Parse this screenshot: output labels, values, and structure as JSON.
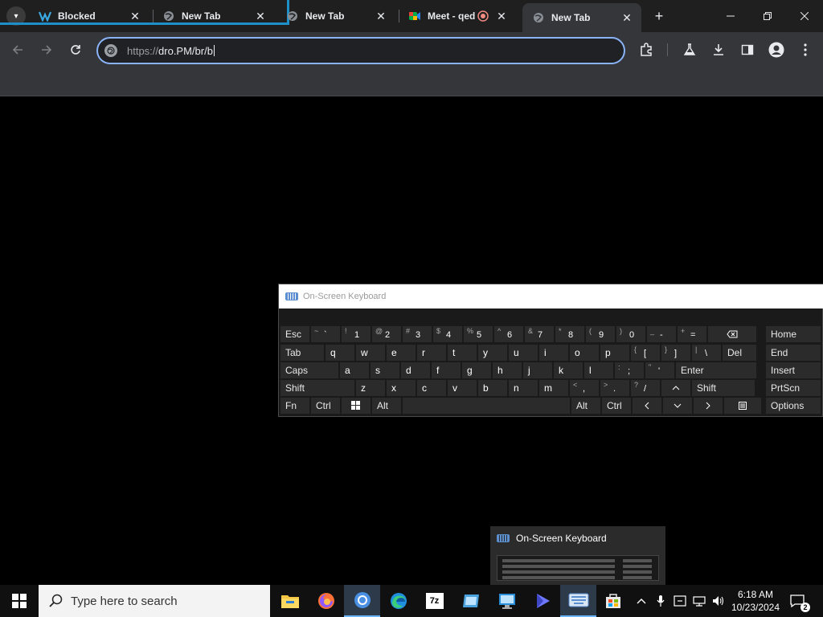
{
  "browser": {
    "tabs": [
      {
        "title": "Blocked",
        "icon": "blocked-favicon"
      },
      {
        "title": "New Tab",
        "icon": "globe-icon"
      },
      {
        "title": "New Tab",
        "icon": "globe-icon"
      },
      {
        "title": "Meet - qed",
        "icon": "meet-icon"
      },
      {
        "title": "New Tab",
        "icon": "globe-icon"
      }
    ],
    "address": {
      "scheme": "https://",
      "value": "dro.PM/br/b"
    },
    "group_color": "#1e90c9"
  },
  "osk": {
    "title": "On-Screen Keyboard",
    "row1": [
      {
        "shift": "~",
        "main": "`"
      },
      {
        "shift": "!",
        "main": "1"
      },
      {
        "shift": "@",
        "main": "2"
      },
      {
        "shift": "#",
        "main": "3"
      },
      {
        "shift": "$",
        "main": "4"
      },
      {
        "shift": "%",
        "main": "5"
      },
      {
        "shift": "^",
        "main": "6"
      },
      {
        "shift": "&",
        "main": "7"
      },
      {
        "shift": "*",
        "main": "8"
      },
      {
        "shift": "(",
        "main": "9"
      },
      {
        "shift": ")",
        "main": "0"
      },
      {
        "shift": "_",
        "main": "-"
      },
      {
        "shift": "+",
        "main": "="
      }
    ],
    "row2_letters": [
      "q",
      "w",
      "e",
      "r",
      "t",
      "y",
      "u",
      "i",
      "o",
      "p"
    ],
    "row2_brackets": [
      {
        "shift": "{",
        "main": "["
      },
      {
        "shift": "}",
        "main": "]"
      },
      {
        "shift": "|",
        "main": "\\"
      }
    ],
    "row3_letters": [
      "a",
      "s",
      "d",
      "f",
      "g",
      "h",
      "j",
      "k",
      "l"
    ],
    "row3_punct": [
      {
        "shift": ":",
        "main": ";"
      },
      {
        "shift": "\"",
        "main": "'"
      }
    ],
    "row4_letters": [
      "z",
      "x",
      "c",
      "v",
      "b",
      "n",
      "m"
    ],
    "row4_punct": [
      {
        "shift": "<",
        "main": ","
      },
      {
        "shift": ">",
        "main": "."
      },
      {
        "shift": "?",
        "main": "/"
      }
    ],
    "labels": {
      "esc": "Esc",
      "tab": "Tab",
      "caps": "Caps",
      "shift": "Shift",
      "fn": "Fn",
      "ctrl": "Ctrl",
      "alt": "Alt",
      "enter": "Enter",
      "del": "Del",
      "home": "Home",
      "end": "End",
      "insert": "Insert",
      "prtscn": "PrtScn",
      "options": "Options"
    }
  },
  "thumbnail": {
    "title": "On-Screen Keyboard"
  },
  "taskbar": {
    "search_placeholder": "Type here to search",
    "apps": [
      "file-explorer-icon",
      "firefox-icon",
      "chrome-icon",
      "edge-icon",
      "7zip-icon",
      "app-icon",
      "remote-desktop-icon",
      "media-player-icon",
      "on-screen-keyboard-icon",
      "store-icon"
    ],
    "app_label_7z": "7z",
    "time": "6:18 AM",
    "date": "10/23/2024",
    "notification_count": "2"
  }
}
